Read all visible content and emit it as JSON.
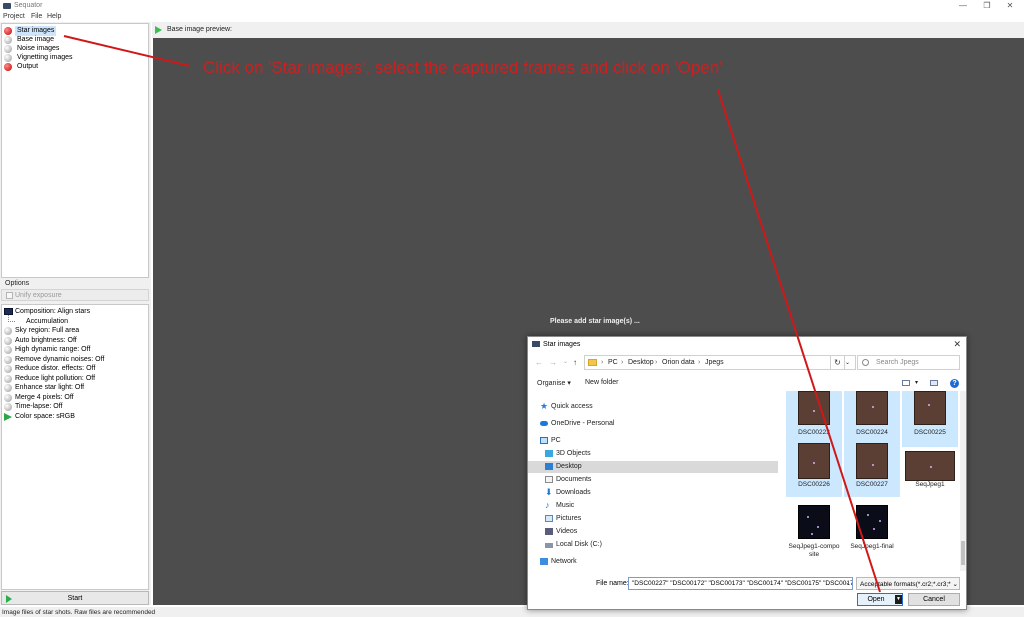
{
  "window": {
    "title": "Sequator",
    "minimize_icon": "minimize-icon",
    "restore_icon": "restore-icon",
    "close_icon": "close-icon",
    "minimize_glyph": "—",
    "restore_glyph": "❐",
    "close_glyph": "✕"
  },
  "menu": [
    "Project",
    "File",
    "Help"
  ],
  "tree": [
    {
      "label": "Star images",
      "status": "red"
    },
    {
      "label": "Base image",
      "status": "grey"
    },
    {
      "label": "Noise images",
      "status": "grey"
    },
    {
      "label": "Vignetting images",
      "status": "grey"
    },
    {
      "label": "Output",
      "status": "red"
    }
  ],
  "options": {
    "title": "Options",
    "unify_label": "Unify exposure",
    "items": [
      {
        "label": "Composition: Align stars",
        "icon": "composition-icon"
      },
      {
        "label": "Accumulation",
        "icon": "tree-branch"
      },
      {
        "label": "Sky region: Full area",
        "icon": "grey-dot"
      },
      {
        "label": "Auto brightness: Off",
        "icon": "grey-dot"
      },
      {
        "label": "High dynamic range: Off",
        "icon": "grey-dot"
      },
      {
        "label": "Remove dynamic noises: Off",
        "icon": "grey-dot"
      },
      {
        "label": "Reduce distor. effects: Off",
        "icon": "grey-dot"
      },
      {
        "label": "Reduce light pollution: Off",
        "icon": "grey-dot"
      },
      {
        "label": "Enhance star light: Off",
        "icon": "grey-dot"
      },
      {
        "label": "Merge 4 pixels: Off",
        "icon": "grey-dot"
      },
      {
        "label": "Time-lapse: Off",
        "icon": "grey-dot"
      },
      {
        "label": "Color space: sRGB",
        "icon": "color-space-icon"
      }
    ]
  },
  "start_label": "Start",
  "status_text": "Image files of star shots. Raw files are recommended",
  "preview_label": "Base image preview:",
  "please_add": "Please add star image(s) ...",
  "annotation": "Click on 'Star images', select the captured frames and click on 'Open'",
  "dialog": {
    "title": "Star images",
    "close_glyph": "✕",
    "nav": {
      "back": "←",
      "forward": "→",
      "dropdown": "⌄",
      "up": "↑"
    },
    "crumbs": [
      "PC",
      "Desktop",
      "Orion data",
      "Jpegs"
    ],
    "crumb_sep": "›",
    "addr_dropdown": "⌄",
    "refresh_glyph": "↻",
    "search_placeholder": "Search Jpegs",
    "organise": "Organise ▾",
    "new_folder": "New folder",
    "view_dropdown": "▾",
    "help_glyph": "?",
    "nav_items": [
      {
        "label": "Quick access",
        "icon": "star-icon"
      },
      {
        "label": "OneDrive - Personal",
        "icon": "cloud-icon"
      },
      {
        "label": "PC",
        "icon": "pc-icon"
      },
      {
        "label": "3D Objects",
        "icon": "cube-icon"
      },
      {
        "label": "Desktop",
        "icon": "desktop-icon"
      },
      {
        "label": "Documents",
        "icon": "documents-icon"
      },
      {
        "label": "Downloads",
        "icon": "downloads-icon"
      },
      {
        "label": "Music",
        "icon": "music-icon"
      },
      {
        "label": "Pictures",
        "icon": "pictures-icon"
      },
      {
        "label": "Videos",
        "icon": "videos-icon"
      },
      {
        "label": "Local Disk (C:)",
        "icon": "disk-icon"
      },
      {
        "label": "Network",
        "icon": "network-icon"
      }
    ],
    "files": [
      {
        "name": "DSC00223",
        "selected": true
      },
      {
        "name": "DSC00224",
        "selected": true
      },
      {
        "name": "DSC00225",
        "selected": true
      },
      {
        "name": "DSC00226",
        "selected": true
      },
      {
        "name": "DSC00227",
        "selected": true
      },
      {
        "name": "SeqJpeg1",
        "selected": false
      },
      {
        "name": "SeqJpeg1-compo site",
        "selected": false
      },
      {
        "name": "SeqJpeg1-final",
        "selected": false
      }
    ],
    "file_name_label": "File name:",
    "file_name_value": "\"DSC00227\" \"DSC00172\" \"DSC00173\" \"DSC00174\" \"DSC00175\" \"DSC00176\" \"",
    "file_name_dropdown": "⌄",
    "filter": "Acceptable formats(*.cr2;*.cr3;* ⌄",
    "open_label": "Open",
    "open_split_glyph": "▼",
    "cancel_label": "Cancel"
  },
  "colors": {
    "annotation": "#cc2020",
    "preview_bg": "#4d4d4d",
    "accent": "#1e6bd6"
  }
}
